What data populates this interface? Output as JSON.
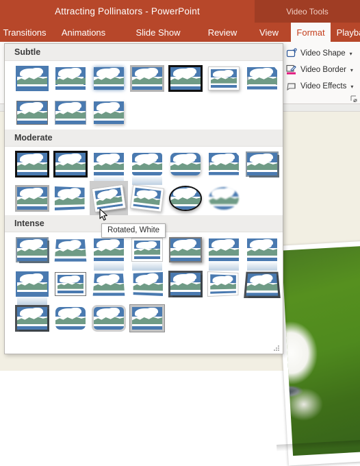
{
  "window": {
    "title": "Attracting Pollinators - PowerPoint",
    "contextual_tools": "Video Tools"
  },
  "theme": {
    "ribbon_red": "#b7472a",
    "ribbon_red_dark": "#a03d24",
    "active_tab_text": "#c43e1c",
    "gallery_bg": "#ffffff",
    "section_header_bg": "#eeedeb",
    "hover_bg": "#cdcdcd",
    "thumb_sky": "#4a7ab0",
    "thumb_hills": "#6f9b86",
    "video_border_accent": "#e3197f"
  },
  "tabs": [
    {
      "label": "Transitions",
      "active": false
    },
    {
      "label": "Animations",
      "active": false
    },
    {
      "label": "Slide Show",
      "active": false
    },
    {
      "label": "Review",
      "active": false
    },
    {
      "label": "View",
      "active": false
    },
    {
      "label": "Format",
      "active": true
    },
    {
      "label": "Playback",
      "active": false
    }
  ],
  "ribbon_group": {
    "items": [
      {
        "label": "Video Shape",
        "icon": "video-shape-icon",
        "caret": "▾"
      },
      {
        "label": "Video Border",
        "icon": "video-border-icon",
        "caret": "▾"
      },
      {
        "label": "Video Effects",
        "icon": "video-effects-icon",
        "caret": "▾"
      }
    ],
    "dialog_launcher": "dialog-box-launcher"
  },
  "gallery": {
    "sections": [
      {
        "title": "Subtle",
        "rows": [
          [
            {
              "style": "f-innerwhite",
              "name": "simple-frame-white"
            },
            {
              "style": "f-blue",
              "name": "beveled-matte-white"
            },
            {
              "style": "f-glow",
              "name": "metal-frame"
            },
            {
              "style": "f-gray",
              "name": "drop-shadow-rectangle"
            },
            {
              "style": "f-black",
              "name": "beveled-oval-black"
            },
            {
              "style": "f-white f-softshadow",
              "name": "simple-frame-black"
            },
            {
              "style": "f-cut",
              "name": "compound-frame-black"
            }
          ],
          [
            {
              "style": "f-thin",
              "name": "moderate-frame-white"
            },
            {
              "style": "f-simple",
              "name": "moderate-frame-black"
            },
            {
              "style": "f-softshadow",
              "name": "center-shadow-rectangle"
            }
          ]
        ]
      },
      {
        "title": "Moderate",
        "rows": [
          [
            {
              "style": "f-compound",
              "name": "compound-frame-black"
            },
            {
              "style": "f-black",
              "name": "thick-matte-black"
            },
            {
              "style": "f-reflect",
              "name": "reflected-rounded-rectangle"
            },
            {
              "style": "f-roundsm f-reflect",
              "name": "soft-edge-rectangle"
            },
            {
              "style": "f-round f-softshadow",
              "name": "rounded-diagonal-corner-white"
            },
            {
              "style": "f-cut",
              "name": "snip-diagonal-corner-white"
            },
            {
              "style": "f-3d",
              "name": "bevel-perspective"
            }
          ],
          [
            {
              "style": "f-grayframe",
              "name": "moderate-frame-gray"
            },
            {
              "style": "f-persp",
              "name": "perspective-shadow-white"
            },
            {
              "style": "f-rotwhite",
              "name": "rotated-white",
              "hovered": true
            },
            {
              "style": "f-rot2 f-white f-softshadow",
              "name": "rotated-white-2"
            },
            {
              "style": "f-ovalblack f-ellipse-shadow",
              "name": "bevel-perspective-left"
            },
            {
              "style": "f-ovalsoft",
              "name": "soft-edge-oval"
            }
          ]
        ]
      },
      {
        "title": "Intense",
        "rows": [
          [
            {
              "style": "f-3d",
              "name": "perspective-relaxed"
            },
            {
              "style": "f-persp2",
              "name": "relaxed-perspective-white"
            },
            {
              "style": "f-reflect",
              "name": "reflected-perspective-right"
            },
            {
              "style": "f-white f-reflect",
              "name": "reflected-bevel-white"
            },
            {
              "style": "f-darkgray f-shadow",
              "name": "reflected-bevel-black"
            },
            {
              "style": "f-reflect",
              "name": "reflected-rounded-rectangle-2"
            },
            {
              "style": "f-reflect",
              "name": "metal-rounded-rectangle"
            }
          ],
          [
            {
              "style": "f-innerwhite f-reflect",
              "name": "metal-oval"
            },
            {
              "style": "f-white f-thin",
              "name": "perspective-shadow-white-2"
            },
            {
              "style": "f-persp2",
              "name": "relaxed-perspective-white-2"
            },
            {
              "style": "f-persp3",
              "name": "moderate-perspective-left"
            },
            {
              "style": "f-3ddark",
              "name": "moderate-perspective-right"
            },
            {
              "style": "f-white f-persp",
              "name": "rotated-gradient"
            },
            {
              "style": "f-3ddark f-persp2",
              "name": "perspective-shadow-black"
            }
          ],
          [
            {
              "style": "f-3ddark",
              "name": "bevel-rectangle"
            },
            {
              "style": "f-round",
              "name": "bevel-rounded-rectangle"
            },
            {
              "style": "f-bevel",
              "name": "soft-edge-bevel"
            },
            {
              "style": "f-plaque",
              "name": "beveled-matte-gray"
            }
          ]
        ]
      }
    ],
    "tooltip": {
      "text": "Rotated, White",
      "visible": true
    }
  }
}
